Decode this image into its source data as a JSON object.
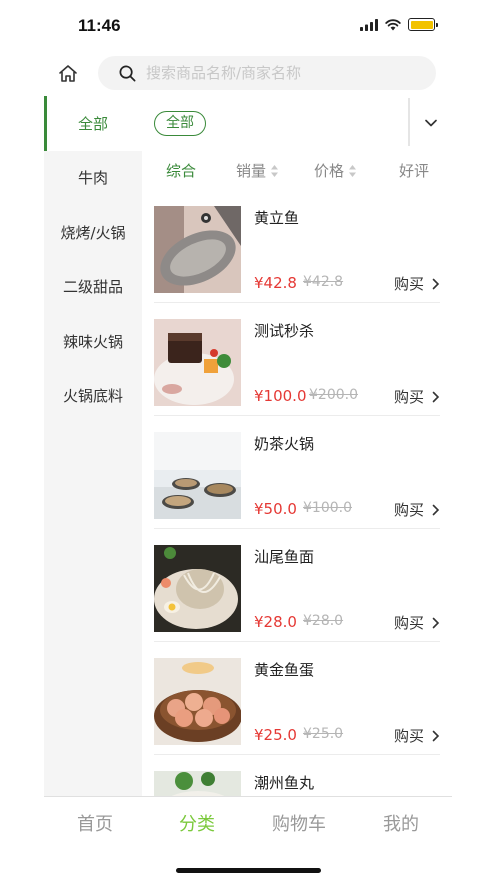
{
  "status_bar": {
    "time": "11:46"
  },
  "search": {
    "placeholder": "搜索商品名称/商家名称"
  },
  "sidebar": {
    "items": [
      {
        "label": "全部",
        "active": true
      },
      {
        "label": "牛肉"
      },
      {
        "label": "烧烤/火锅"
      },
      {
        "label": "二级甜品"
      },
      {
        "label": "辣味火锅"
      },
      {
        "label": "火锅底料"
      }
    ]
  },
  "subcategory": {
    "chip": "全部"
  },
  "sort": {
    "items": [
      {
        "label": "综合",
        "active": true
      },
      {
        "label": "销量"
      },
      {
        "label": "价格"
      },
      {
        "label": "好评"
      }
    ]
  },
  "products": [
    {
      "name": "黄立鱼",
      "price": "¥42.8",
      "old_price": "¥42.8",
      "buy": "购买"
    },
    {
      "name": "测试秒杀",
      "price": "¥100.0",
      "old_price": "¥200.0",
      "buy": "购买"
    },
    {
      "name": "奶茶火锅",
      "price": "¥50.0",
      "old_price": "¥100.0",
      "buy": "购买"
    },
    {
      "name": "汕尾鱼面",
      "price": "¥28.0",
      "old_price": "¥28.0",
      "buy": "购买"
    },
    {
      "name": "黄金鱼蛋",
      "price": "¥25.0",
      "old_price": "¥25.0",
      "buy": "购买"
    },
    {
      "name": "潮州鱼丸",
      "price": "",
      "old_price": "",
      "buy": ""
    }
  ],
  "tabbar": {
    "items": [
      {
        "label": "首页"
      },
      {
        "label": "分类",
        "active": true
      },
      {
        "label": "购物车"
      },
      {
        "label": "我的"
      }
    ]
  },
  "colors": {
    "accent": "#3a8a3a",
    "tab_active": "#7bc93c",
    "price": "#e53935",
    "battery": "#f2c200"
  },
  "icons": [
    "home-icon",
    "search-icon",
    "chevron-down-icon",
    "sort-arrows-icon",
    "chevron-right-icon",
    "signal-icon",
    "wifi-icon",
    "battery-icon"
  ]
}
